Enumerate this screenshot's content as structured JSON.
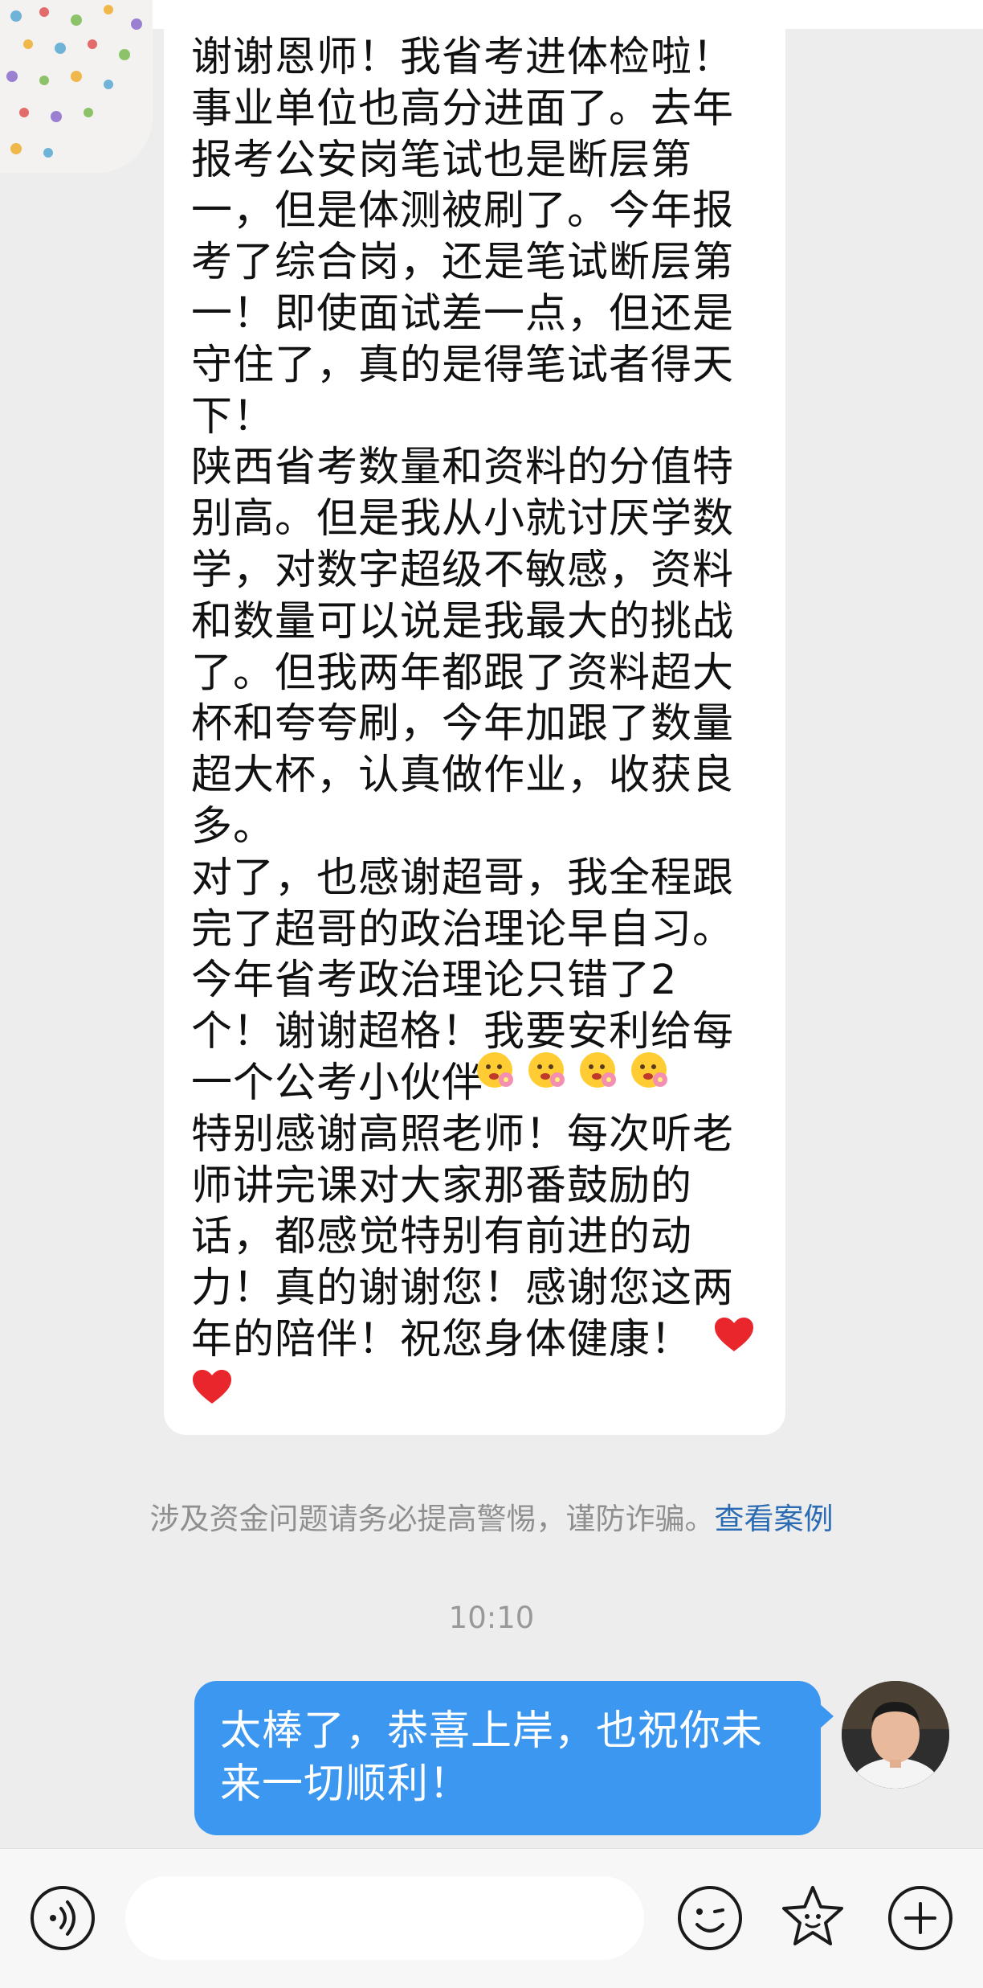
{
  "incoming_message": {
    "text": "谢谢恩师！我省考进体检啦！\n事业单位也高分进面了。去年\n报考公安岗笔试也是断层第\n一，但是体测被刷了。今年报\n考了综合岗，还是笔试断层第\n一！即使面试差一点，但还是\n守住了，真的是得笔试者得天\n下！\n陕西省考数量和资料的分值特\n别高。但是我从小就讨厌学数\n学，对数字超级不敏感，资料\n和数量可以说是我最大的挑战\n了。但我两年都跟了资料超大\n杯和夸夸刷，今年加跟了数量\n超大杯，认真做作业，收获良\n多。\n对了，也感谢超哥，我全程跟\n完了超哥的政治理论早自习。\n今年省考政治理论只错了2\n个！谢谢超格！我要安利给每\n一个公考小伙伴\n特别感谢高照老师！每次听老\n师讲完课对大家那番鼓励的\n话，都感觉特别有前进的动\n力！真的谢谢您！感谢您这两\n年的陪伴！祝您身体健康！"
  },
  "notice": {
    "text": "涉及资金问题请务必提高警惕，谨防诈骗。",
    "link": "查看案例"
  },
  "timestamp": "10:10",
  "outgoing_message": {
    "text": "太棒了，恭喜上岸，也祝你未来一切顺利！"
  },
  "icons": {
    "voice": "voice-icon",
    "emoji": "emoji-icon",
    "sticker": "sticker-icon",
    "more": "plus-icon"
  },
  "colors": {
    "outgoing_bubble": "#3b97f0",
    "link": "#2b6bb3",
    "background": "#ededed"
  }
}
